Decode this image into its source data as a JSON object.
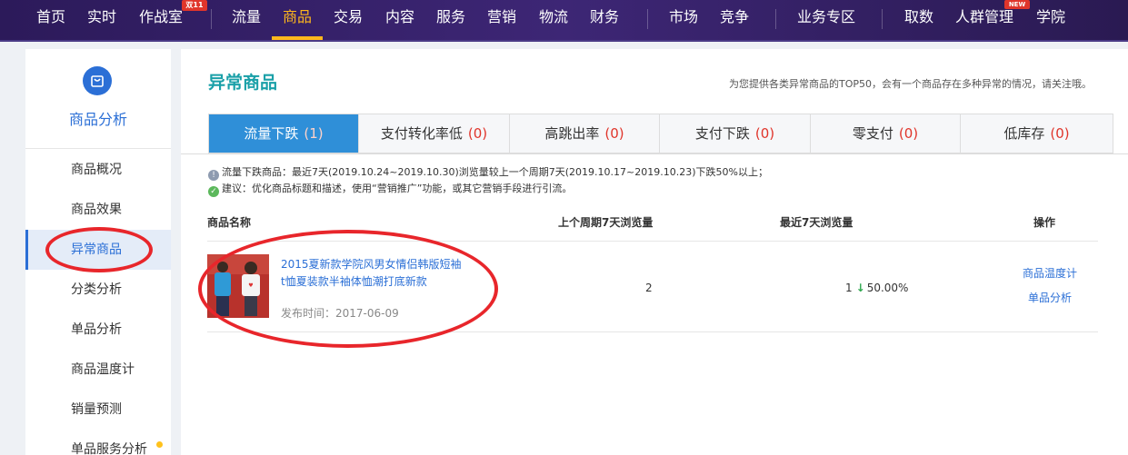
{
  "topnav": {
    "items": [
      "首页",
      "实时",
      "作战室",
      "流量",
      "商品",
      "交易",
      "内容",
      "服务",
      "营销",
      "物流",
      "财务",
      "市场",
      "竞争",
      "业务专区",
      "取数",
      "人群管理",
      "学院"
    ],
    "active": "商品",
    "badge_double11": "双11",
    "badge_new": "NEW"
  },
  "sidebar": {
    "title": "商品分析",
    "icon": "shopping-bag-icon",
    "items": [
      "商品概况",
      "商品效果",
      "异常商品",
      "分类分析",
      "单品分析",
      "商品温度计",
      "销量预测",
      "单品服务分析"
    ],
    "active": "异常商品"
  },
  "main": {
    "title": "异常商品",
    "hint": "为您提供各类异常商品的TOP50，会有一个商品存在多种异常的情况，请关注哦。",
    "tabs": [
      {
        "label": "流量下跌",
        "count": "(1)"
      },
      {
        "label": "支付转化率低",
        "count": "(0)"
      },
      {
        "label": "高跳出率",
        "count": "(0)"
      },
      {
        "label": "支付下跌",
        "count": "(0)"
      },
      {
        "label": "零支付",
        "count": "(0)"
      },
      {
        "label": "低库存",
        "count": "(0)"
      }
    ],
    "notes": {
      "warn": "流量下跌商品：最近7天(2019.10.24~2019.10.30)浏览量较上一个周期7天(2019.10.17~2019.10.23)下跌50%以上；",
      "advice": "建议：优化商品标题和描述，使用“营销推广”功能，或其它营销手段进行引流。"
    },
    "table": {
      "headers": [
        "商品名称",
        "上个周期7天浏览量",
        "最近7天浏览量",
        "操作"
      ],
      "rows": [
        {
          "title": "2015夏新款学院风男女情侣韩版短袖t恤夏装款半袖体恤潮打底新款",
          "date": "发布时间：2017-06-09",
          "prev": "2",
          "recent": "1",
          "change": "50.00%",
          "ops": [
            "商品温度计",
            "单品分析"
          ]
        }
      ]
    }
  },
  "colors": {
    "nav_bg": "#3d2675",
    "nav_active": "#ffb81c",
    "accent_blue": "#2b6fd6",
    "tab_active": "#2f8fd8",
    "title_teal": "#1aa0a8",
    "count_red": "#e0352b",
    "down_green": "#2fa84f",
    "annotation_red": "#e8262b"
  }
}
